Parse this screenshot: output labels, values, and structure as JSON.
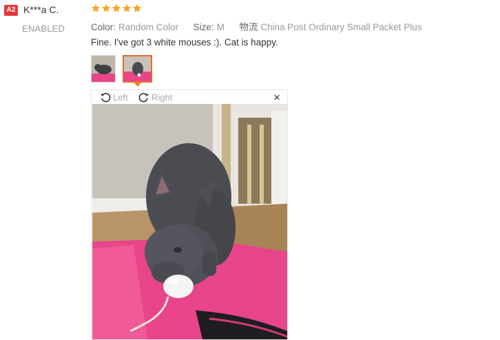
{
  "reviewer": {
    "country_code": "A2",
    "name": "K***a C.",
    "status": "ENABLED"
  },
  "rating": {
    "stars": 5,
    "max": 5,
    "color": "#f5a623"
  },
  "product_meta": {
    "color_label": "Color:",
    "color_value": "Random Color",
    "size_label": "Size:",
    "size_value": "M",
    "shipping_label": "物流",
    "shipping_value": "China Post Ordinary Small Packet Plus"
  },
  "review_text": "Fine. I've got 3 white mouses :). Cat is happy.",
  "viewer": {
    "rotate_left_label": "Left",
    "rotate_right_label": "Right",
    "close_label": "×"
  },
  "thumbnails": [
    {
      "name": "review-photo-thumbnail-1",
      "active": false
    },
    {
      "name": "review-photo-thumbnail-2",
      "active": true
    }
  ],
  "colors": {
    "accent": "#e56b2e",
    "badge": "#e4393c",
    "pink_mat": "#e8458a"
  }
}
